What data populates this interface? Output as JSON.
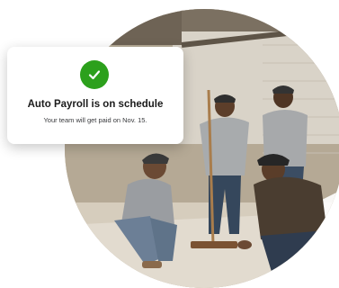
{
  "notification": {
    "icon": "check-circle-icon",
    "title": "Auto Payroll is on schedule",
    "subtitle": "Your team will get paid on Nov. 15."
  },
  "colors": {
    "success": "#2ca01c",
    "title_text": "#1b1b1b",
    "subtitle_text": "#393a3d"
  },
  "illustration": {
    "icon": "workers-photo"
  }
}
